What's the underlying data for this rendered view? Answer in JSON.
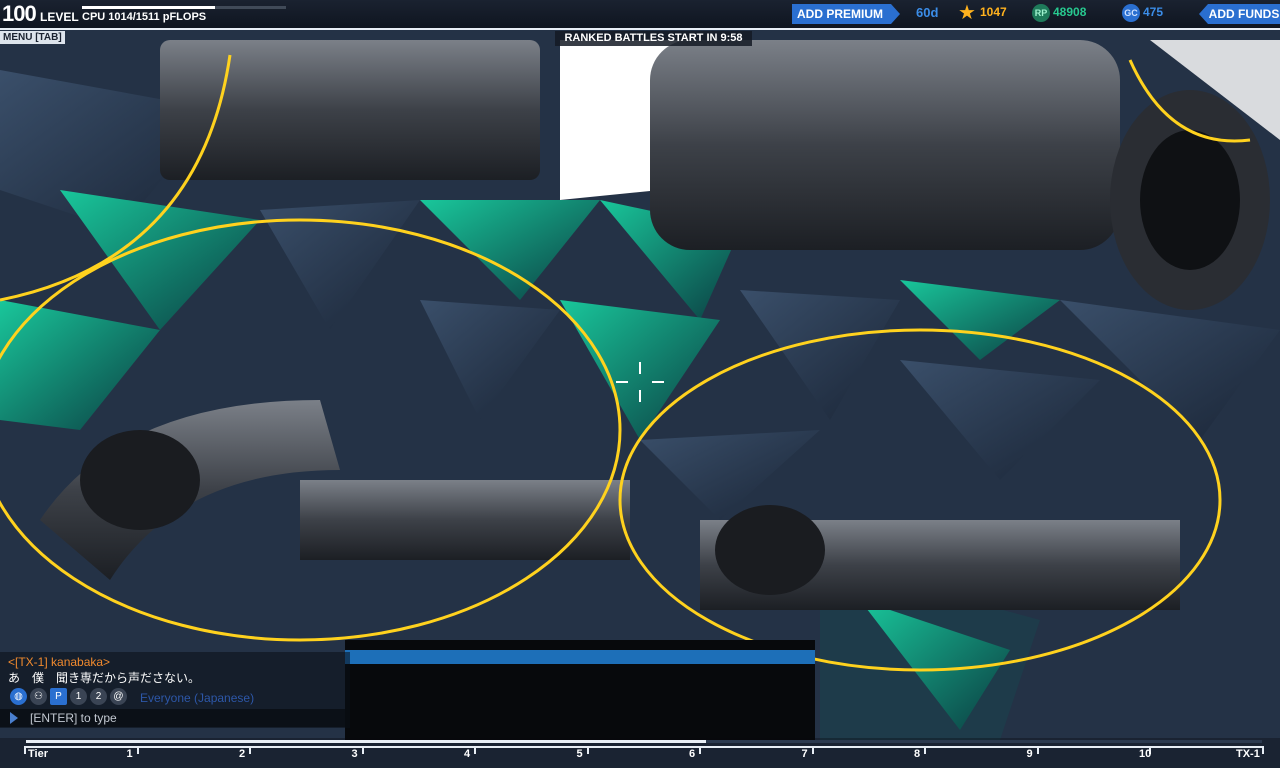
{
  "topbar": {
    "level": "100",
    "level_label": "LEVEL",
    "level_progress": 0.65,
    "cpu_text": "CPU 1014/1511 pFLOPS",
    "premium_label": "ADD PREMIUM",
    "premium_days": "60d",
    "star_value": "1047",
    "rp_icon": "RP",
    "rp_value": "48908",
    "gc_icon": "GC",
    "gc_value": "475",
    "funds_label": "ADD FUNDS"
  },
  "menu_label": "MENU [TAB]",
  "ranked_text": "RANKED BATTLES START IN 9:58",
  "chat": {
    "sender": "<[TX-1] kanabaka>",
    "message": "あ　僕　聞き専だから声ださない。",
    "icon_p": "P",
    "icon_1": "1",
    "icon_2": "2",
    "channel": "Everyone (Japanese)",
    "input_hint": "[ENTER] to type"
  },
  "tiers": {
    "progress": 0.55,
    "labels": [
      "Tier",
      "1",
      "2",
      "3",
      "4",
      "5",
      "6",
      "7",
      "8",
      "9",
      "10",
      "TX-1"
    ]
  },
  "colors": {
    "accent_blue": "#2a6fd0",
    "overlay_yellow": "#ffd21e",
    "chat_sender": "#f08a2e",
    "teal_panel": "#1fa88a"
  }
}
